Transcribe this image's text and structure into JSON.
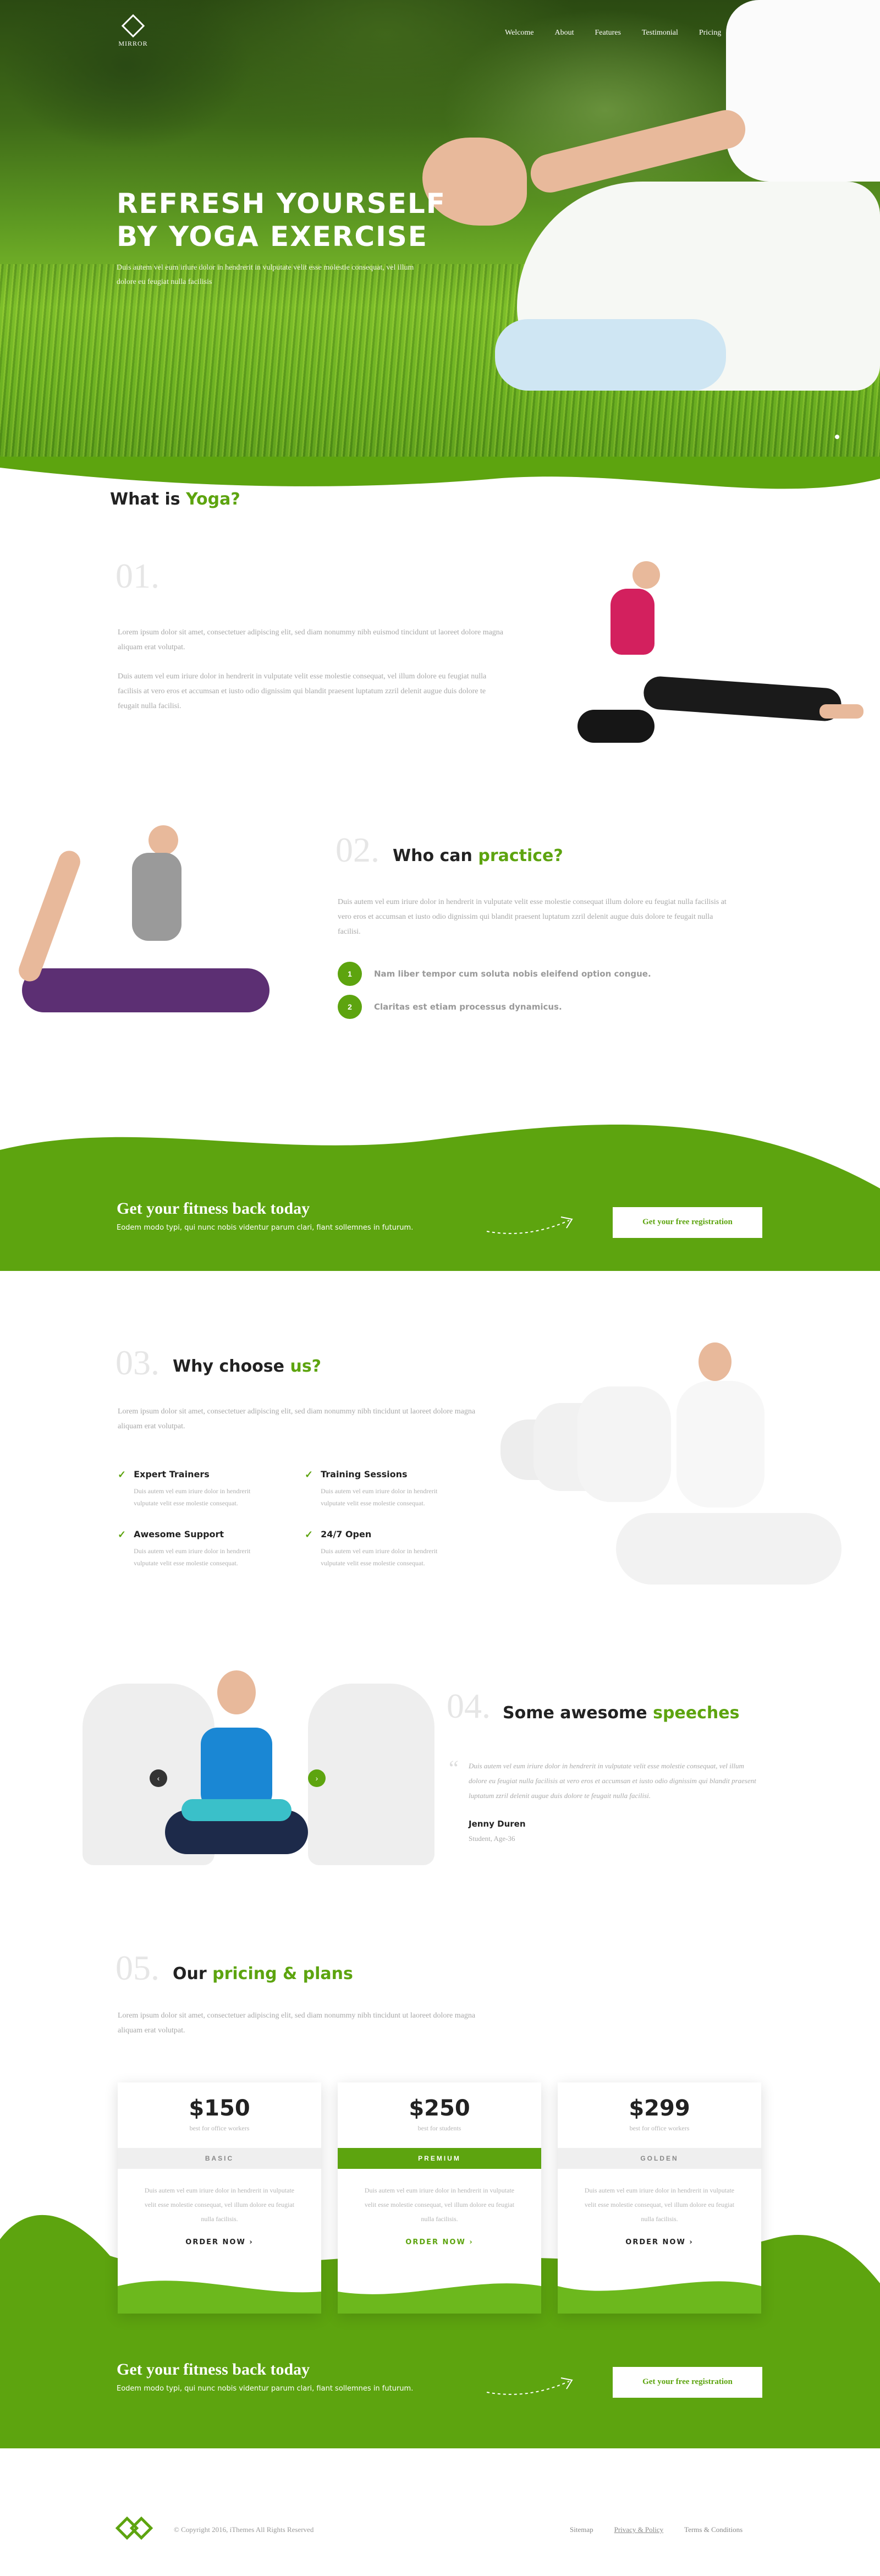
{
  "header": {
    "logo_text": "MIRROR",
    "nav": [
      "Welcome",
      "About",
      "Features",
      "Testimonial",
      "Pricing"
    ]
  },
  "hero": {
    "title_line1": "REFRESH YOURSELF",
    "title_line2": "BY YOGA EXERCISE",
    "text": "Duis autem vel eum iriure dolor in hendrerit in vulputate velit esse molestie consequat, vel illum dolore eu feugiat nulla facilisis"
  },
  "what": {
    "title_pre": "What is ",
    "title_accent": "Yoga?"
  },
  "s1": {
    "num": "01.",
    "p1": "Lorem ipsum dolor sit amet, consectetuer adipiscing elit, sed diam nonummy nibh euismod tincidunt ut laoreet dolore magna aliquam erat volutpat.",
    "p2": "Duis autem vel eum iriure dolor in hendrerit in vulputate velit esse molestie consequat, vel illum dolore eu feugiat nulla facilisis at vero eros et accumsan et iusto odio dignissim qui blandit praesent luptatum zzril delenit augue duis dolore te feugait nulla facilisi."
  },
  "s2": {
    "num": "02.",
    "title_pre": "Who can ",
    "title_accent": "practice?",
    "text": "Duis autem vel eum iriure dolor in hendrerit in vulputate velit esse molestie consequat illum dolore eu feugiat nulla facilisis at vero eros et accumsan et iusto odio dignissim qui blandit praesent luptatum zzril delenit augue duis dolore te feugait nulla facilisi.",
    "items": [
      {
        "n": "1",
        "t": "Nam liber tempor cum soluta nobis eleifend option congue."
      },
      {
        "n": "2",
        "t": "Claritas est etiam processus dynamicus."
      }
    ]
  },
  "cta": {
    "title": "Get your fitness back today",
    "text": "Eodem modo typi, qui nunc nobis videntur parum clari, fiant sollemnes in futurum.",
    "button": "Get your free registration"
  },
  "s3": {
    "num": "03.",
    "title_pre": "Why choose ",
    "title_accent": "us?",
    "text": "Lorem ipsum dolor sit amet, consectetuer adipiscing elit, sed diam nonummy nibh tincidunt ut laoreet dolore magna aliquam erat volutpat.",
    "features": [
      {
        "t": "Expert Trainers",
        "d": "Duis autem vel eum iriure dolor in hendrerit vulputate velit esse molestie consequat."
      },
      {
        "t": "Training Sessions",
        "d": "Duis autem vel eum iriure dolor in hendrerit vulputate velit esse molestie consequat."
      },
      {
        "t": "Awesome Support",
        "d": "Duis autem vel eum iriure dolor in hendrerit vulputate velit esse molestie consequat."
      },
      {
        "t": "24/7 Open",
        "d": "Duis autem vel eum iriure dolor in hendrerit vulputate velit esse molestie consequat."
      }
    ]
  },
  "s4": {
    "num": "04.",
    "title_pre": "Some awesome ",
    "title_accent": "speeches",
    "quote": "Duis autem vel eum iriure dolor in hendrerit in vulputate velit esse molestie consequat, vel illum dolore eu feugiat nulla facilisis at vero eros et accumsan et iusto odio dignissim qui blandit praesent luptatum zzril delenit augue duis dolore te feugait nulla facilisi.",
    "name": "Jenny Duren",
    "role": "Student, Age-36"
  },
  "s5": {
    "num": "05.",
    "title_pre": "Our ",
    "title_accent": "pricing & plans",
    "text": "Lorem ipsum dolor sit amet, consectetuer adipiscing elit, sed diam nonummy nibh tincidunt ut laoreet dolore magna aliquam erat volutpat.",
    "plans": [
      {
        "price": "$150",
        "sub": "best for office workers",
        "tier": "BASIC",
        "desc": "Duis autem vel eum iriure dolor in hendrerit in vulputate velit esse molestie consequat, vel illum dolore eu feugiat nulla facilisis.",
        "order": "ORDER NOW"
      },
      {
        "price": "$250",
        "sub": "best for students",
        "tier": "PREMIUM",
        "desc": "Duis autem vel eum iriure dolor in hendrerit in vulputate velit esse molestie consequat, vel illum dolore eu feugiat nulla facilisis.",
        "order": "ORDER NOW"
      },
      {
        "price": "$299",
        "sub": "best for office workers",
        "tier": "GOLDEN",
        "desc": "Duis autem vel eum iriure dolor in hendrerit in vulputate velit esse molestie consequat, vel illum dolore eu feugiat nulla facilisis.",
        "order": "ORDER NOW"
      }
    ]
  },
  "footer": {
    "copyright": "© Copyright 2016, iThemes All Rights Reserved",
    "links": [
      "Sitemap",
      "Privacy & Policy",
      "Terms & Conditions"
    ]
  },
  "colors": {
    "accent": "#5da40f"
  }
}
